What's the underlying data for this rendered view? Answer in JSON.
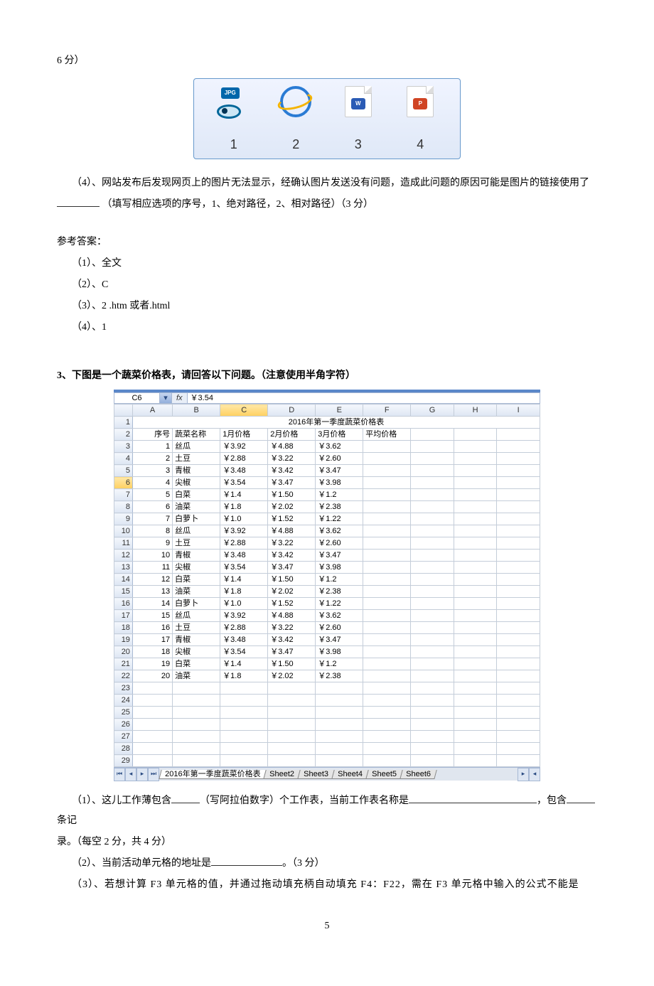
{
  "q2": {
    "pre_icons": "6 分）",
    "icons": [
      "1",
      "2",
      "3",
      "4"
    ],
    "p4_a": "（4）、网站发布后发现网页上的图片无法显示，经确认图片发送没有问题，造成此问题的原因可能是图片的链接使用了",
    "p4_b": "（填写相应选项的序号，1、绝对路径，2、相对路径）（3 分）",
    "ans_title": "参考答案：",
    "a1": "（1）、全文",
    "a2": "（2）、C",
    "a3": "（3）、2           .htm 或者.html",
    "a4": "（4）、1"
  },
  "q3": {
    "header": "3、下图是一个蔬菜价格表，请回答以下问题。（注意使用半角字符）",
    "p1_a": "（1）、这儿工作薄包含",
    "p1_b": "（写阿拉伯数字）个工作表，当前工作表名称是",
    "p1_c": "，包含",
    "p1_d": "条记",
    "p1_e": "录。（每空 2 分，共 4 分）",
    "p2_a": "（2）、当前活动单元格的地址是",
    "p2_b": "。（3 分）",
    "p3": "（3）、若想计算 F3 单元格的值，并通过拖动填充柄自动填充 F4：F22，需在 F3 单元格中输入的公式不能是"
  },
  "excel": {
    "cell_name": "C6",
    "fx": "fx",
    "formula_value": "￥3.54",
    "title": "2016年第一季度蔬菜价格表",
    "cols": [
      "",
      "A",
      "B",
      "C",
      "D",
      "E",
      "F",
      "G",
      "H",
      "I"
    ],
    "headers_r2": [
      "序号",
      "蔬菜名称",
      "1月价格",
      "2月价格",
      "3月价格",
      "平均价格",
      "",
      "",
      ""
    ],
    "active_col": "C",
    "active_row": 6,
    "sheets": [
      "2016年第一季度蔬菜价格表",
      "Sheet2",
      "Sheet3",
      "Sheet4",
      "Sheet5",
      "Sheet6"
    ]
  },
  "chart_data": {
    "type": "table",
    "title": "2016年第一季度蔬菜价格表",
    "columns": [
      "序号",
      "蔬菜名称",
      "1月价格",
      "2月价格",
      "3月价格",
      "平均价格"
    ],
    "rows": [
      [
        1,
        "丝瓜",
        "￥3.92",
        "￥4.88",
        "￥3.62",
        ""
      ],
      [
        2,
        "土豆",
        "￥2.88",
        "￥3.22",
        "￥2.60",
        ""
      ],
      [
        3,
        "青椒",
        "￥3.48",
        "￥3.42",
        "￥3.47",
        ""
      ],
      [
        4,
        "尖椒",
        "￥3.54",
        "￥3.47",
        "￥3.98",
        ""
      ],
      [
        5,
        "白菜",
        "￥1.4",
        "￥1.50",
        "￥1.2",
        ""
      ],
      [
        6,
        "油菜",
        "￥1.8",
        "￥2.02",
        "￥2.38",
        ""
      ],
      [
        7,
        "白萝卜",
        "￥1.0",
        "￥1.52",
        "￥1.22",
        ""
      ],
      [
        8,
        "丝瓜",
        "￥3.92",
        "￥4.88",
        "￥3.62",
        ""
      ],
      [
        9,
        "土豆",
        "￥2.88",
        "￥3.22",
        "￥2.60",
        ""
      ],
      [
        10,
        "青椒",
        "￥3.48",
        "￥3.42",
        "￥3.47",
        ""
      ],
      [
        11,
        "尖椒",
        "￥3.54",
        "￥3.47",
        "￥3.98",
        ""
      ],
      [
        12,
        "白菜",
        "￥1.4",
        "￥1.50",
        "￥1.2",
        ""
      ],
      [
        13,
        "油菜",
        "￥1.8",
        "￥2.02",
        "￥2.38",
        ""
      ],
      [
        14,
        "白萝卜",
        "￥1.0",
        "￥1.52",
        "￥1.22",
        ""
      ],
      [
        15,
        "丝瓜",
        "￥3.92",
        "￥4.88",
        "￥3.62",
        ""
      ],
      [
        16,
        "土豆",
        "￥2.88",
        "￥3.22",
        "￥2.60",
        ""
      ],
      [
        17,
        "青椒",
        "￥3.48",
        "￥3.42",
        "￥3.47",
        ""
      ],
      [
        18,
        "尖椒",
        "￥3.54",
        "￥3.47",
        "￥3.98",
        ""
      ],
      [
        19,
        "白菜",
        "￥1.4",
        "￥1.50",
        "￥1.2",
        ""
      ],
      [
        20,
        "油菜",
        "￥1.8",
        "￥2.02",
        "￥2.38",
        ""
      ]
    ]
  },
  "page_num": "5"
}
